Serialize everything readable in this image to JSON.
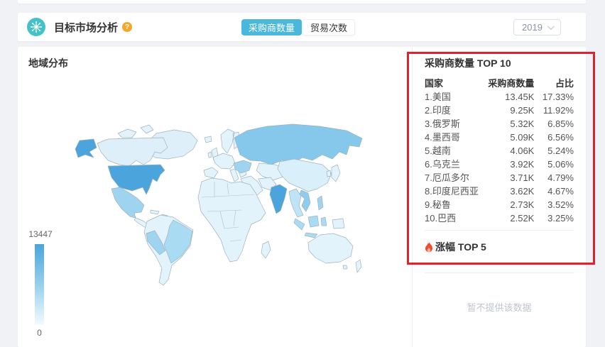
{
  "header": {
    "title": "目标市场分析",
    "help": "?",
    "toggle": [
      {
        "label": "采购商数量",
        "active": true
      },
      {
        "label": "贸易次数",
        "active": false
      }
    ],
    "year": "2019"
  },
  "map_panel": {
    "title": "地域分布",
    "legend": {
      "max": "13447",
      "min": "0",
      "top_color": "#49a6db",
      "bottom_color": "#f4fbff"
    },
    "palette": {
      "base": "#e3f3fc",
      "light": "#deeffa",
      "rank1": "#4ba5dc",
      "high": "#85c8eb",
      "mid": "#a9dcf3",
      "mid2": "#9ed4ef",
      "mid3": "#8fccee",
      "mid4": "#bfe4f6",
      "low": "#d9effa"
    }
  },
  "top10": {
    "title": "采购商数量 TOP 10",
    "columns": [
      "国家",
      "采购商数量",
      "占比"
    ],
    "rows": [
      {
        "name": "1.美国",
        "value": "13.45K",
        "share": "17.33%"
      },
      {
        "name": "2.印度",
        "value": "9.25K",
        "share": "11.92%"
      },
      {
        "name": "3.俄罗斯",
        "value": "5.32K",
        "share": "6.85%"
      },
      {
        "name": "4.墨西哥",
        "value": "5.09K",
        "share": "6.56%"
      },
      {
        "name": "5.越南",
        "value": "4.06K",
        "share": "5.24%"
      },
      {
        "name": "6.乌克兰",
        "value": "3.92K",
        "share": "5.06%"
      },
      {
        "name": "7.厄瓜多尔",
        "value": "3.71K",
        "share": "4.79%"
      },
      {
        "name": "8.印度尼西亚",
        "value": "3.62K",
        "share": "4.67%"
      },
      {
        "name": "9.秘鲁",
        "value": "2.73K",
        "share": "3.52%"
      },
      {
        "name": "10.巴西",
        "value": "2.52K",
        "share": "3.25%"
      }
    ]
  },
  "rise": {
    "title": "涨幅 TOP 5",
    "empty": "暂不提供该数据"
  },
  "annotation": {
    "color": "#e62129"
  },
  "chart_data": {
    "type": "heatmap",
    "subtype": "world-choropleth",
    "title": "地域分布",
    "metric": "采购商数量",
    "value_range": [
      0,
      13447
    ],
    "legend_position": "bottom-left",
    "points": [
      {
        "country": "美国",
        "value": "13.45K",
        "share": "17.33%"
      },
      {
        "country": "印度",
        "value": "9.25K",
        "share": "11.92%"
      },
      {
        "country": "俄罗斯",
        "value": "5.32K",
        "share": "6.85%"
      },
      {
        "country": "墨西哥",
        "value": "5.09K",
        "share": "6.56%"
      },
      {
        "country": "越南",
        "value": "4.06K",
        "share": "5.24%"
      },
      {
        "country": "乌克兰",
        "value": "3.92K",
        "share": "5.06%"
      },
      {
        "country": "厄瓜多尔",
        "value": "3.71K",
        "share": "4.79%"
      },
      {
        "country": "印度尼西亚",
        "value": "3.62K",
        "share": "4.67%"
      },
      {
        "country": "秘鲁",
        "value": "2.73K",
        "share": "3.52%"
      },
      {
        "country": "巴西",
        "value": "2.52K",
        "share": "3.25%"
      }
    ]
  }
}
